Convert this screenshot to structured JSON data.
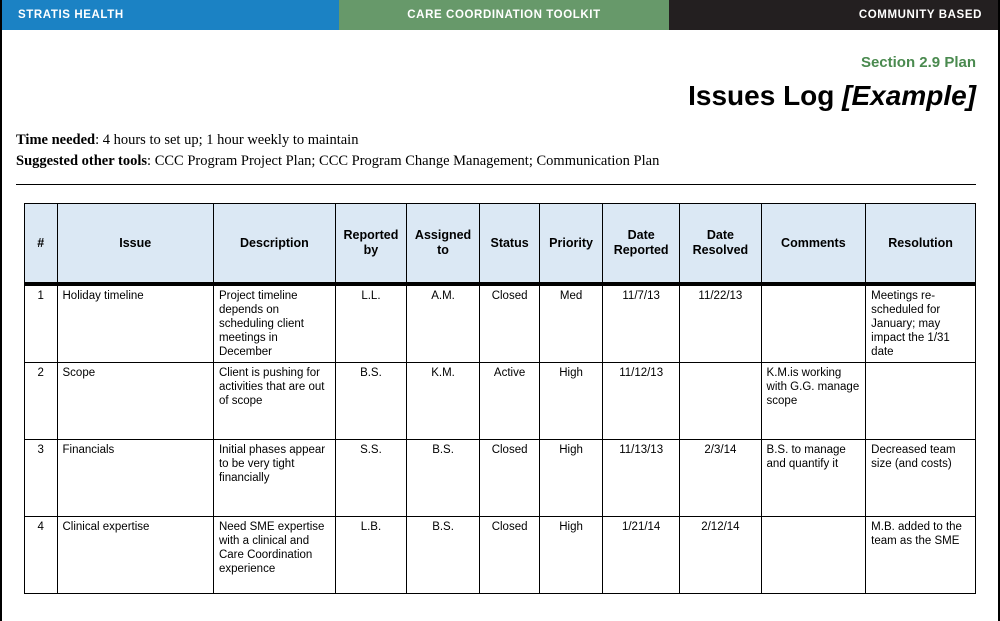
{
  "banner": {
    "brand": "STRATIS HEALTH",
    "toolkit": "CARE COORDINATION TOOLKIT",
    "audience": "COMMUNITY BASED",
    "brand_color": "#1b82c4",
    "toolkit_color": "#67996a",
    "audience_color": "#231f20"
  },
  "title": {
    "section_label": "Section 2.9 Plan",
    "main": "Issues Log ",
    "example": "[Example]",
    "section_color": "#4a8a4f"
  },
  "meta": {
    "time_needed_label": "Time needed",
    "time_needed_value": ": 4 hours to set up; 1 hour weekly to maintain",
    "suggested_tools_label": "Suggested other tools",
    "suggested_tools_value": ": CCC Program Project Plan; CCC Program Change Management; Communication Plan"
  },
  "table": {
    "header_bg": "#dbe8f4",
    "columns": [
      "#",
      "Issue",
      "Description",
      "Reported by",
      "Assigned to",
      "Status",
      "Priority",
      "Date Reported",
      "Date Resolved",
      "Comments",
      "Resolution"
    ],
    "rows": [
      {
        "num": "1",
        "issue": "Holiday timeline",
        "description": "Project timeline depends on scheduling client meetings in December",
        "reported_by": "L.L.",
        "assigned_to": "A.M.",
        "status": "Closed",
        "priority": "Med",
        "date_reported": "11/7/13",
        "date_resolved": "11/22/13",
        "comments": "",
        "resolution": "Meetings re-scheduled for January; may impact the 1/31 date"
      },
      {
        "num": "2",
        "issue": "Scope",
        "description": "Client is pushing for activities that are out of scope",
        "reported_by": "B.S.",
        "assigned_to": "K.M.",
        "status": "Active",
        "priority": "High",
        "date_reported": "11/12/13",
        "date_resolved": "",
        "comments": "K.M.is working with G.G. manage scope",
        "resolution": ""
      },
      {
        "num": "3",
        "issue": "Financials",
        "description": "Initial phases appear to be very tight financially",
        "reported_by": "S.S.",
        "assigned_to": "B.S.",
        "status": "Closed",
        "priority": "High",
        "date_reported": "11/13/13",
        "date_resolved": "2/3/14",
        "comments": "B.S. to manage and quantify it",
        "resolution": "Decreased team size (and costs)"
      },
      {
        "num": "4",
        "issue": "Clinical expertise",
        "description": "Need SME expertise with a clinical and Care Coordination experience",
        "reported_by": "L.B.",
        "assigned_to": "B.S.",
        "status": "Closed",
        "priority": "High",
        "date_reported": "1/21/14",
        "date_resolved": "2/12/14",
        "comments": "",
        "resolution": "M.B. added to the team as the SME"
      }
    ]
  }
}
